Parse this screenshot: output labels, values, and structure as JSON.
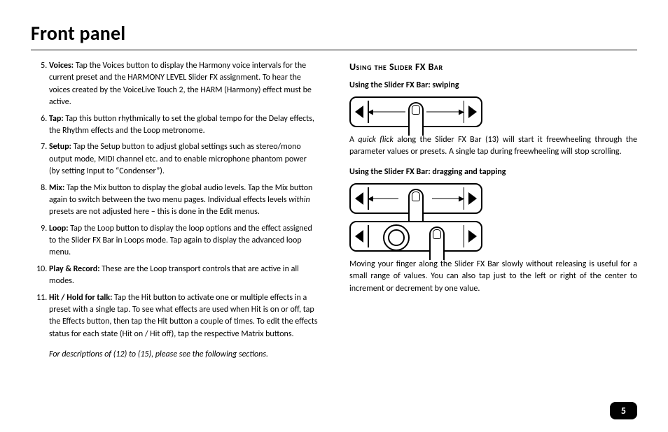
{
  "title": "Front panel",
  "list_start": 5,
  "items": [
    {
      "term": "Voices:",
      "body": "Tap the Voices button to display the Harmony voice intervals for the current preset and the HARMONY LEVEL Slider FX assignment. To hear the voices created by the VoiceLive Touch 2, the HARM (Harmony) effect must be active."
    },
    {
      "term": "Tap:",
      "body": "Tap this button rhythmically to set the global tempo for the Delay effects, the Rhythm effects and the Loop metronome."
    },
    {
      "term": "Setup:",
      "body": "Tap the Setup button to adjust global settings such as stereo/mono output mode, MIDI channel etc. and to enable microphone phantom power (by setting Input to “Condenser”)."
    },
    {
      "term": "Mix:",
      "body_pre": "Tap the Mix button to display the global audio levels. Tap the Mix button again to switch between the two menu pages. Individual effects levels ",
      "body_italic": "within",
      "body_post": " presets are not adjusted here – this is done in the Edit menus."
    },
    {
      "term": "Loop:",
      "body": "Tap the Loop button to display the loop options and the effect assigned to the Slider FX Bar in Loops mode. Tap again to display the advanced loop menu."
    },
    {
      "term": "Play & Record:",
      "body": "These are the Loop transport controls that are active in all modes."
    },
    {
      "term": "Hit / Hold for talk:",
      "body": "Tap the Hit button to activate one or multiple effects in a preset with a single tap. To see what effects are used when Hit is on or off, tap the Effects button, then tap the Hit button a couple of times. To edit the effects status for each state (Hit on / Hit off), tap the respective Matrix buttons."
    }
  ],
  "footnote": "For descriptions of (12) to (15), please see the following sections.",
  "right": {
    "heading": "Using the Slider FX Bar",
    "sub1": "Using the Slider FX Bar: swiping",
    "para1_pre": "A ",
    "para1_italic": "quick flick",
    "para1_post": " along the Slider FX Bar (13) will start it freewheeling through the parameter values or presets. A single tap during freewheeling will stop scrolling.",
    "sub2": "Using the Slider FX Bar: dragging and tapping",
    "para2": "Moving your finger along the Slider FX Bar slowly without releasing is useful for a small range of values. You can also tap just to the left or right of the center to increment or decrement by one value."
  },
  "page_number": "5"
}
